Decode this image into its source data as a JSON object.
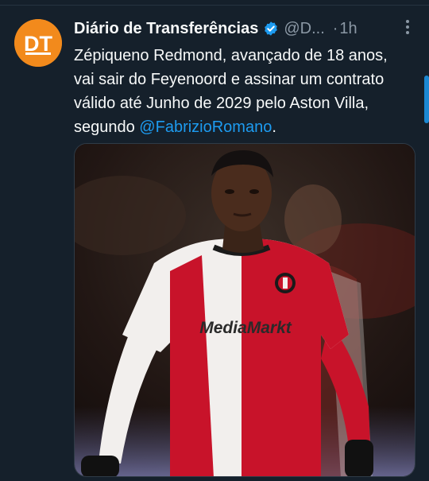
{
  "tweet": {
    "author_name": "Diário de Transferências",
    "handle": "@D...",
    "separator": "·",
    "time": "1h",
    "avatar_text": "DT",
    "text_before_mention": "Zépiqueno Redmond, avançado de 18 anos, vai sair do Feyenoord e assinar um contrato válido até Junho de 2029 pelo Aston Villa, segundo ",
    "mention": "@FabrizioRomano",
    "text_after_mention": ".",
    "media": {
      "shirt_sponsor": "MediaMarkt"
    }
  },
  "colors": {
    "background": "#15202b",
    "accent": "#1d9bf0",
    "avatar": "#f28a1c",
    "text_secondary": "#8b98a5"
  },
  "icons": [
    "verified-badge-icon",
    "more-options-icon"
  ]
}
